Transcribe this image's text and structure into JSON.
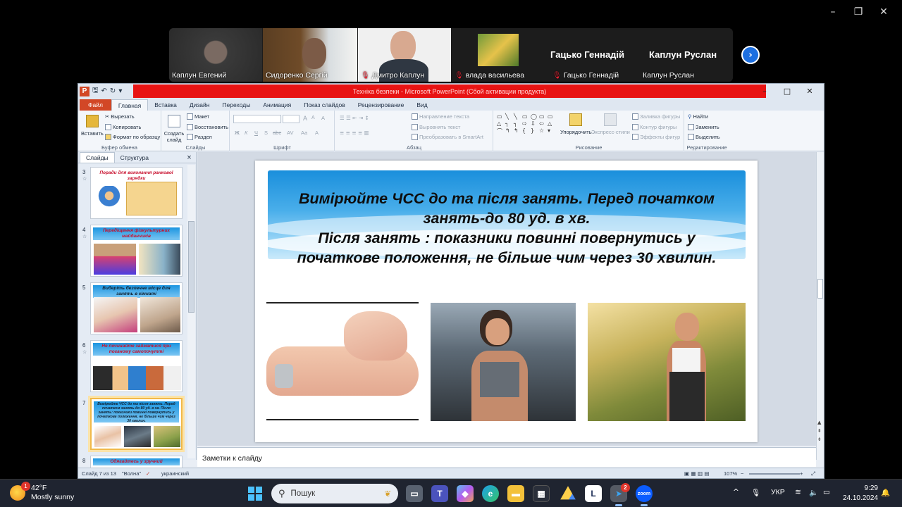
{
  "window_controls": {
    "minimize": "–",
    "maximize": "❐",
    "close": "✕"
  },
  "participants": {
    "tiles": [
      {
        "name": "Каплун Евгений",
        "muted": false
      },
      {
        "name": "Сидоренко Сергій",
        "muted": false
      },
      {
        "name": "Дмитро Каплун",
        "muted": true
      },
      {
        "name": "влада васильева",
        "muted": true
      },
      {
        "name": "Гацько Геннадій",
        "muted": true
      },
      {
        "name": "Каплун Руслан",
        "muted": false
      }
    ],
    "big_names": [
      "Гацько Геннадій",
      "Каплун Руслан"
    ],
    "next_icon": "›"
  },
  "ppt": {
    "title": "Техніка безпеки  -  Microsoft PowerPoint (Сбой активации продукта)",
    "controls": {
      "minimize": "–",
      "maximize": "□",
      "close": "✕"
    },
    "tabs": [
      "Файл",
      "Главная",
      "Вставка",
      "Дизайн",
      "Переходы",
      "Анимация",
      "Показ слайдов",
      "Рецензирование",
      "Вид"
    ],
    "ribbon": {
      "clipboard": {
        "paste": "Вставить",
        "cut": "Вырезать",
        "copy": "Копировать",
        "format": "Формат по образцу",
        "name": "Буфер обмена"
      },
      "slides": {
        "new": "Создать слайд",
        "layout": "Макет",
        "reset": "Восстановить",
        "section": "Раздел",
        "name": "Слайды"
      },
      "font": {
        "name": "Шрифт",
        "bold": "Ж",
        "italic": "К",
        "underline": "Ч",
        "strike": "S",
        "abc": "abc",
        "av": "AV",
        "aa": "Aa",
        "a": "A",
        "grow": "A",
        "shrink": "A",
        "clear": "A"
      },
      "paragraph": {
        "direction": "Направление текста",
        "align": "Выровнять текст",
        "smartart": "Преобразовать в SmartArt",
        "name": "Абзац"
      },
      "drawing": {
        "arrange": "Упорядочить",
        "quickstyles": "Экспресс-стили",
        "fill": "Заливка фигуры",
        "outline": "Контур фигуры",
        "effects": "Эффекты фигур",
        "name": "Рисование"
      },
      "editing": {
        "find": "Найти",
        "replace": "Заменить",
        "select": "Выделить",
        "name": "Редактирование"
      }
    },
    "left_tabs": {
      "slides": "Слайды",
      "outline": "Структура",
      "close": "×"
    },
    "thumbs": [
      {
        "num": "3",
        "title": "Поради для виконання ранкової зарядки"
      },
      {
        "num": "4",
        "title": "Передіщення фізкультурних майданчиків"
      },
      {
        "num": "5",
        "title": "Виберіть безпечне місце для занять в кімнаті"
      },
      {
        "num": "6",
        "title": "Не починайте займатися при поганому самопочутті"
      },
      {
        "num": "7",
        "title": "Вимірюйте ЧСС до та після занять. Перед початком занять-до 80 уд. в хв. Після занять: показники повинні повернутись у початкове положення, не більше чим через 30 хвилин."
      },
      {
        "num": "8",
        "title": "Одягайтесь у зручний"
      }
    ],
    "slide": {
      "line1": "Вимірюйте ЧСС до та після занять.  Перед початком",
      "line2": "занять-до 80 уд. в  хв.",
      "line3": "Після занять : показники повинні повернутись  у",
      "line4": "початкове положення,  не більше чим через 30 хвилин."
    },
    "notes_placeholder": "Заметки к слайду",
    "status": {
      "slide": "Слайд 7 из 13",
      "theme": "\"Волна\"",
      "lang": "украинский",
      "zoom": "107%",
      "zoom_minus": "−",
      "zoom_plus": "+"
    }
  },
  "taskbar": {
    "weather": {
      "temp": "42°F",
      "desc": "Mostly sunny",
      "badge": "1"
    },
    "search_placeholder": "Пошук",
    "lang": "УКР",
    "time": "9:29",
    "date": "24.10.2024",
    "telegram_badge": "2",
    "chevron": "^"
  }
}
